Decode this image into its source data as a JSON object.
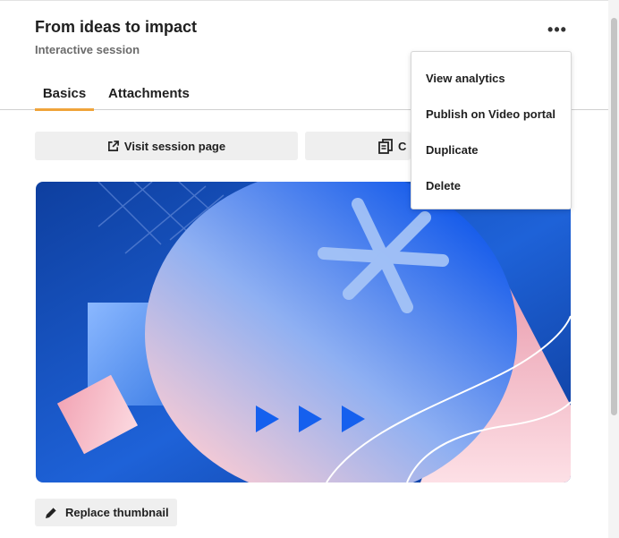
{
  "header": {
    "title": "From ideas to impact",
    "subtitle": "Interactive session",
    "more_icon": "more-horizontal-icon"
  },
  "tabs": [
    {
      "label": "Basics",
      "active": true
    },
    {
      "label": "Attachments",
      "active": false
    }
  ],
  "actions": {
    "visit_label": "Visit session page",
    "visit_icon": "external-link-icon",
    "copy_label": "C",
    "copy_icon": "copy-icon"
  },
  "thumbnail": {
    "alt": "Session thumbnail",
    "colors": {
      "blue": "#1e5fe0",
      "pink": "#f5c6d0",
      "deep": "#0d3c9e"
    }
  },
  "replace": {
    "label": "Replace thumbnail",
    "icon": "pencil-icon"
  },
  "menu": {
    "items": [
      {
        "label": "View analytics"
      },
      {
        "label": "Publish on Video portal"
      },
      {
        "label": "Duplicate"
      },
      {
        "label": "Delete"
      }
    ]
  },
  "colors": {
    "accent": "#f0a43a",
    "button_bg": "#efefef"
  }
}
